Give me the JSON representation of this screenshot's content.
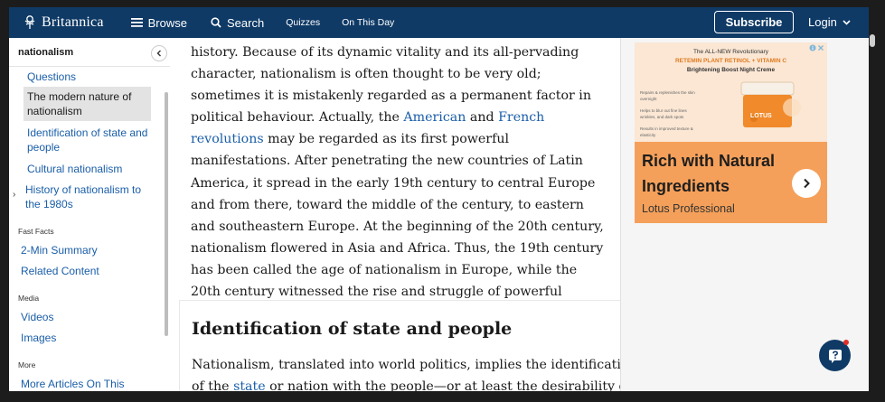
{
  "header": {
    "brand": "Britannica",
    "browse": "Browse",
    "search": "Search",
    "quizzes": "Quizzes",
    "on_this_day": "On This Day",
    "subscribe": "Subscribe",
    "login": "Login"
  },
  "sidebar": {
    "title": "nationalism",
    "items": [
      {
        "label": "Questions"
      },
      {
        "label": "The modern nature of nationalism"
      },
      {
        "label": "Identification of state and people"
      },
      {
        "label": "Cultural nationalism"
      },
      {
        "label": "History of nationalism to the 1980s"
      }
    ],
    "fast_facts_label": "Fast Facts",
    "fast_facts": [
      "2-Min Summary",
      "Related Content"
    ],
    "media_label": "Media",
    "media": [
      "Videos",
      "Images"
    ],
    "more_label": "More",
    "more": [
      "More Articles On This"
    ]
  },
  "article": {
    "p1_a": "history. Because of its dynamic vitality and its all-pervading character, nationalism is often thought to be very old; sometimes it is mistakenly regarded as a permanent factor in political behaviour. Actually, the ",
    "link_american": "American",
    "p1_and": " and ",
    "link_french": "French revolutions",
    "p1_b": " may be regarded as its first powerful manifestations. After penetrating the new countries of Latin America, it spread in the early 19th century to central Europe and from there, toward the middle of the century, to eastern and southeastern Europe. At the beginning of the 20th century, nationalism flowered in Asia and Africa. Thus, the 19th century has been called the age of nationalism in Europe, while the 20th century witnessed the rise and struggle of powerful national movements throughout Asia and Africa.",
    "heading": "Identification of state and people",
    "p2_line1": "Nationalism, translated into world politics, implies the identification",
    "p2_a": "of the ",
    "link_state": "state",
    "p2_b": " or nation with the people—or at least the desirability of"
  },
  "ad": {
    "line1": "The ALL-NEW Revolutionary",
    "line2": "RETEMIN PLANT RETINOL + VITAMIN C",
    "line3": "Brightening Boost Night Creme",
    "bullets": [
      "Repairs & replenishes the skin overnight",
      "Helps to blur out fine lines wrinkles, and dark spots",
      "Results in improved texture & elasticity"
    ],
    "jar_label": "LOTUS",
    "headline_1": "Rich with Natural",
    "headline_2": "Ingredients",
    "brand": "Lotus Professional"
  },
  "colors": {
    "header_bg": "#0f3a66",
    "link": "#1a5ea8",
    "ad_orange": "#f5a05a"
  }
}
